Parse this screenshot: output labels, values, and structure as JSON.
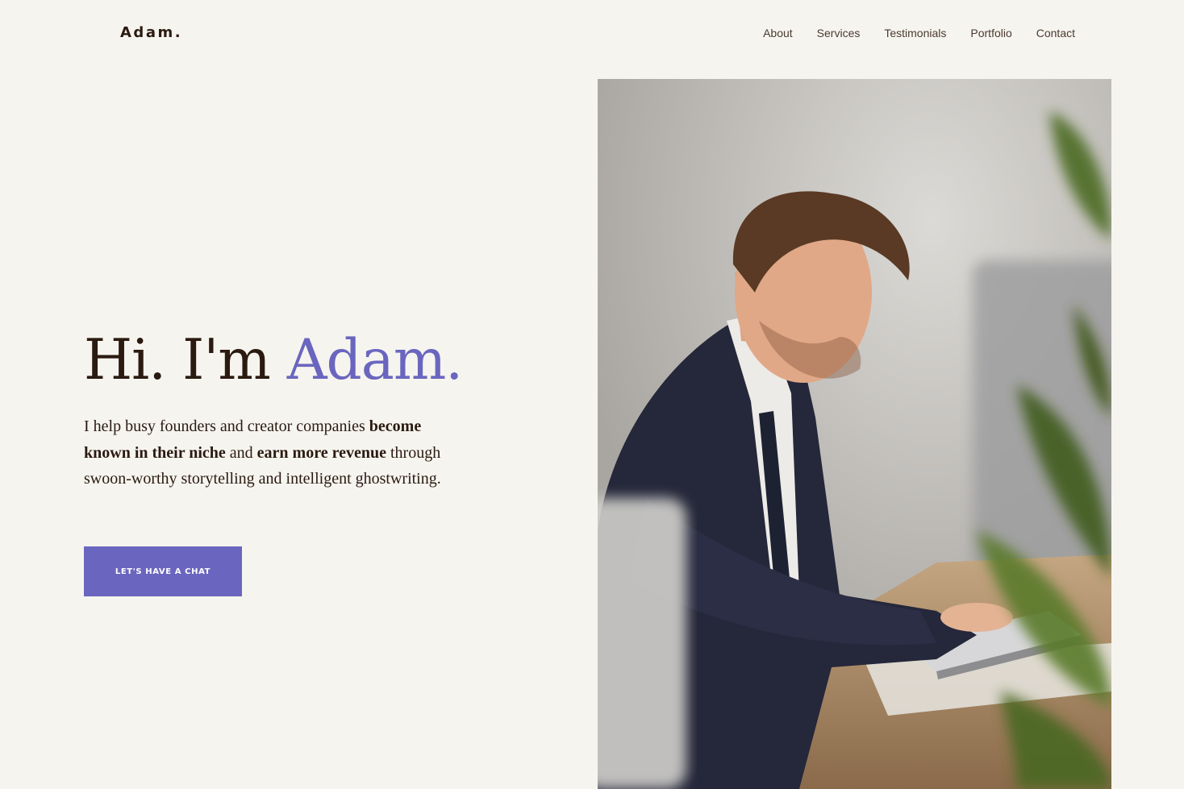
{
  "header": {
    "logo": "Adam.",
    "nav": [
      "About",
      "Services",
      "Testimonials",
      "Portfolio",
      "Contact"
    ]
  },
  "hero": {
    "title_lead": "Hi. I'm",
    "title_accent": "Adam.",
    "intro": {
      "t1": "I help busy founders and creator companies ",
      "b1": "become known in their niche",
      "t2": " and ",
      "b2": "earn more revenue",
      "t3": " through swoon-worthy storytelling and intelligent ghostwriting."
    },
    "cta_label": "LET'S HAVE A CHAT"
  },
  "colors": {
    "background": "#f6f4ef",
    "accent": "#6a66bf",
    "text": "#2a1a10"
  },
  "image": {
    "icon": "portrait-photo"
  }
}
